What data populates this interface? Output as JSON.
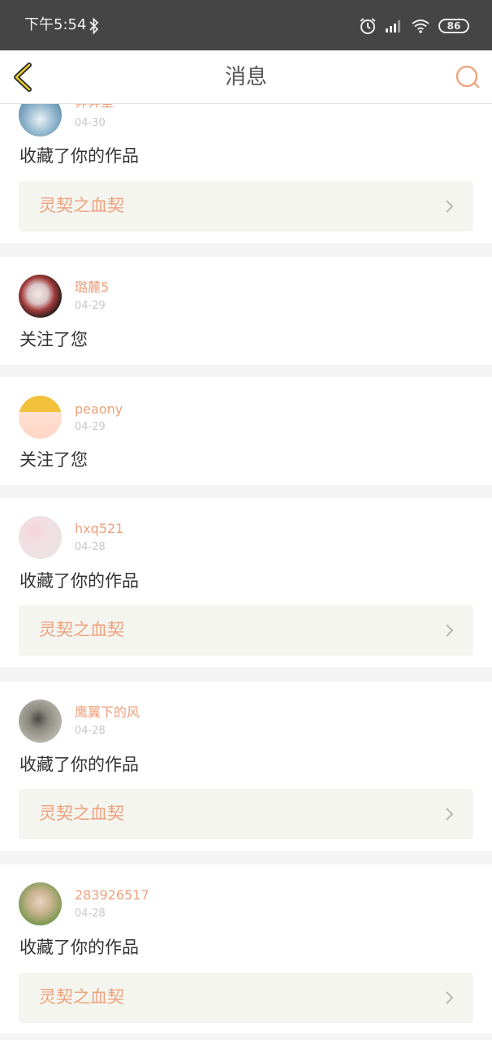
{
  "status_bar": {
    "time": "下午5:54",
    "battery": "86"
  },
  "navbar": {
    "title": "消息"
  },
  "messages": [
    {
      "user": "莽莽堂",
      "date": "04-30",
      "action": "收藏了你的作品",
      "work": "灵契之血契"
    },
    {
      "user": "璐麓5",
      "date": "04-29",
      "action": "关注了您"
    },
    {
      "user": "peaony",
      "date": "04-29",
      "action": "关注了您"
    },
    {
      "user": "hxq521",
      "date": "04-28",
      "action": "收藏了你的作品",
      "work": "灵契之血契"
    },
    {
      "user": "鹰翼下的风",
      "date": "04-28",
      "action": "收藏了你的作品",
      "work": "灵契之血契"
    },
    {
      "user": "283926517",
      "date": "04-28",
      "action": "收藏了你的作品",
      "work": "灵契之血契"
    }
  ]
}
